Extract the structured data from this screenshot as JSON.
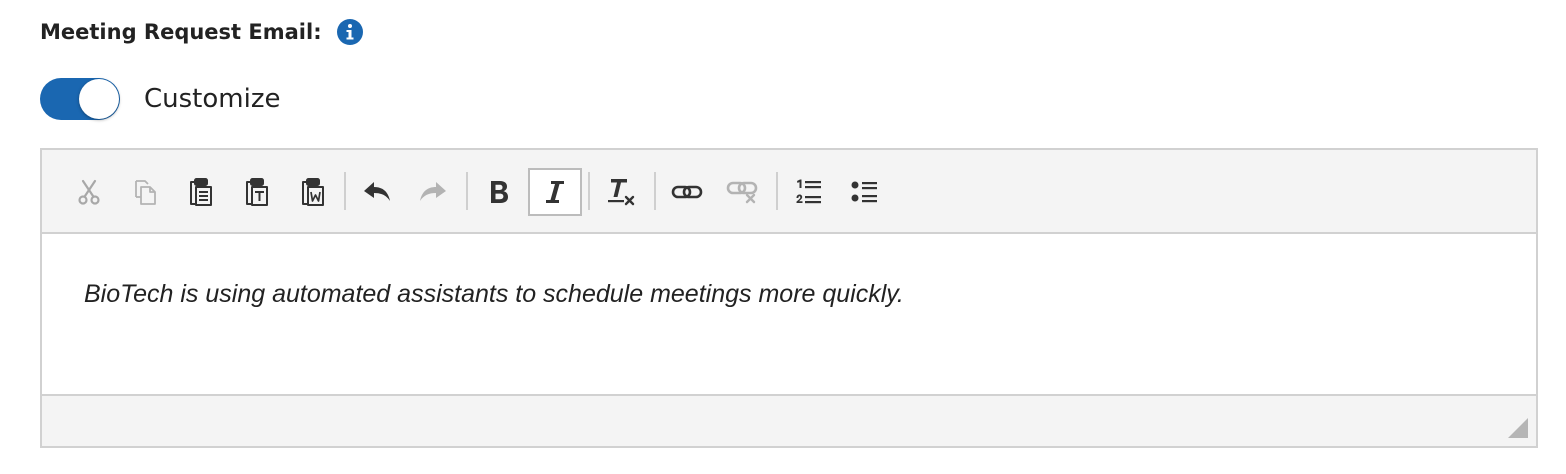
{
  "field": {
    "label": "Meeting Request Email:",
    "info_icon": "info-circle-icon"
  },
  "customize": {
    "label": "Customize",
    "enabled": true,
    "accent_color": "#1a67b1"
  },
  "editor": {
    "toolbar": [
      {
        "name": "cut",
        "icon": "scissors-icon",
        "enabled": false
      },
      {
        "name": "copy",
        "icon": "copy-icon",
        "enabled": false
      },
      {
        "name": "paste",
        "icon": "clipboard-icon",
        "enabled": true
      },
      {
        "name": "paste-as-text",
        "icon": "clipboard-text-icon",
        "enabled": true
      },
      {
        "name": "paste-from-word",
        "icon": "clipboard-word-icon",
        "enabled": true
      },
      {
        "name": "undo",
        "icon": "undo-icon",
        "enabled": true
      },
      {
        "name": "redo",
        "icon": "redo-icon",
        "enabled": false
      },
      {
        "name": "bold",
        "icon": "bold-icon",
        "enabled": true,
        "active": false
      },
      {
        "name": "italic",
        "icon": "italic-icon",
        "enabled": true,
        "active": true
      },
      {
        "name": "remove-format",
        "icon": "remove-format-icon",
        "enabled": true
      },
      {
        "name": "link",
        "icon": "link-icon",
        "enabled": true
      },
      {
        "name": "unlink",
        "icon": "unlink-icon",
        "enabled": false
      },
      {
        "name": "numbered-list",
        "icon": "numbered-list-icon",
        "enabled": true
      },
      {
        "name": "bulleted-list",
        "icon": "bulleted-list-icon",
        "enabled": true
      }
    ],
    "content": "BioTech is using automated assistants to schedule meetings more quickly."
  }
}
